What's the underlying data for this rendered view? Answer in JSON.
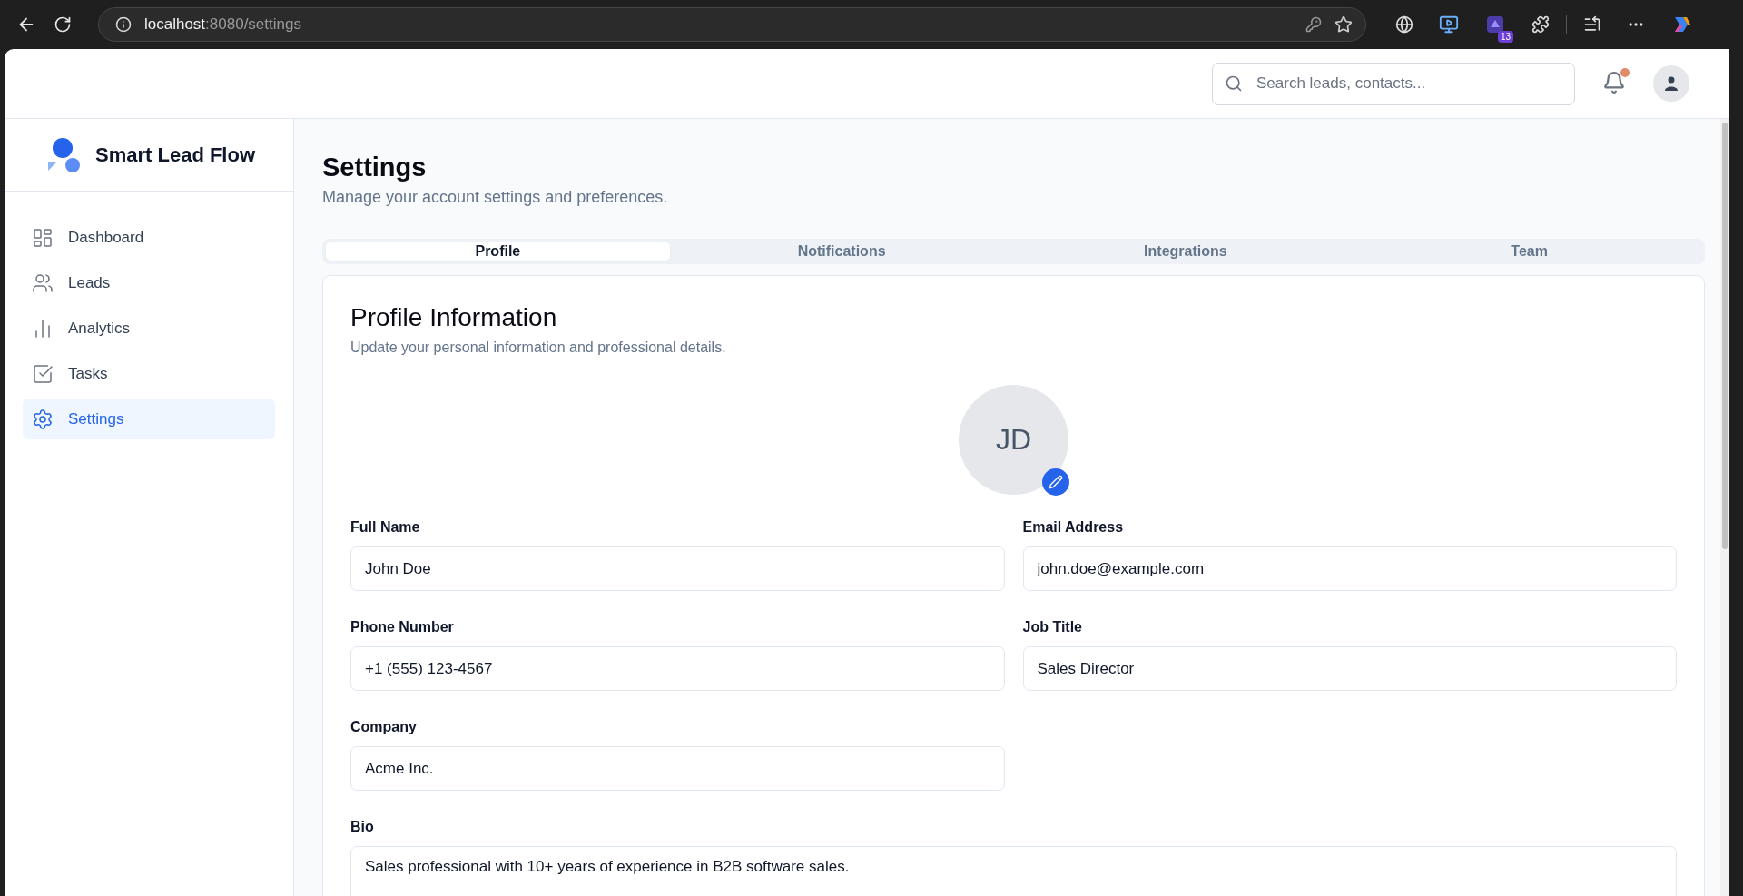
{
  "browser": {
    "url_host": "localhost",
    "url_path": ":8080/settings",
    "extension_badge": "13"
  },
  "header": {
    "search": {
      "placeholder": "Search leads, contacts..."
    },
    "notifications": {
      "unread": true
    }
  },
  "sidebar": {
    "brand": "Smart Lead Flow",
    "items": [
      {
        "label": "Dashboard",
        "selected": false
      },
      {
        "label": "Leads",
        "selected": false
      },
      {
        "label": "Analytics",
        "selected": false
      },
      {
        "label": "Tasks",
        "selected": false
      },
      {
        "label": "Settings",
        "selected": true
      }
    ]
  },
  "page": {
    "title": "Settings",
    "subtitle": "Manage your account settings and preferences."
  },
  "tabs": [
    {
      "label": "Profile",
      "selected": true
    },
    {
      "label": "Notifications",
      "selected": false
    },
    {
      "label": "Integrations",
      "selected": false
    },
    {
      "label": "Team",
      "selected": false
    }
  ],
  "profile": {
    "title": "Profile Information",
    "subtitle": "Update your personal information and professional details.",
    "avatar": {
      "initials": "JD"
    },
    "fields": [
      {
        "label": "Full Name",
        "value": "John Doe",
        "kind": "input"
      },
      {
        "label": "Email Address",
        "value": "john.doe@example.com",
        "kind": "input"
      },
      {
        "label": "Phone Number",
        "value": "+1 (555) 123-4567",
        "kind": "input"
      },
      {
        "label": "Job Title",
        "value": "Sales Director",
        "kind": "input"
      },
      {
        "label": "Company",
        "value": "Acme Inc.",
        "kind": "input"
      },
      {
        "label": "Bio",
        "value": "Sales professional with 10+ years of experience in B2B software sales.",
        "kind": "textarea"
      }
    ]
  }
}
